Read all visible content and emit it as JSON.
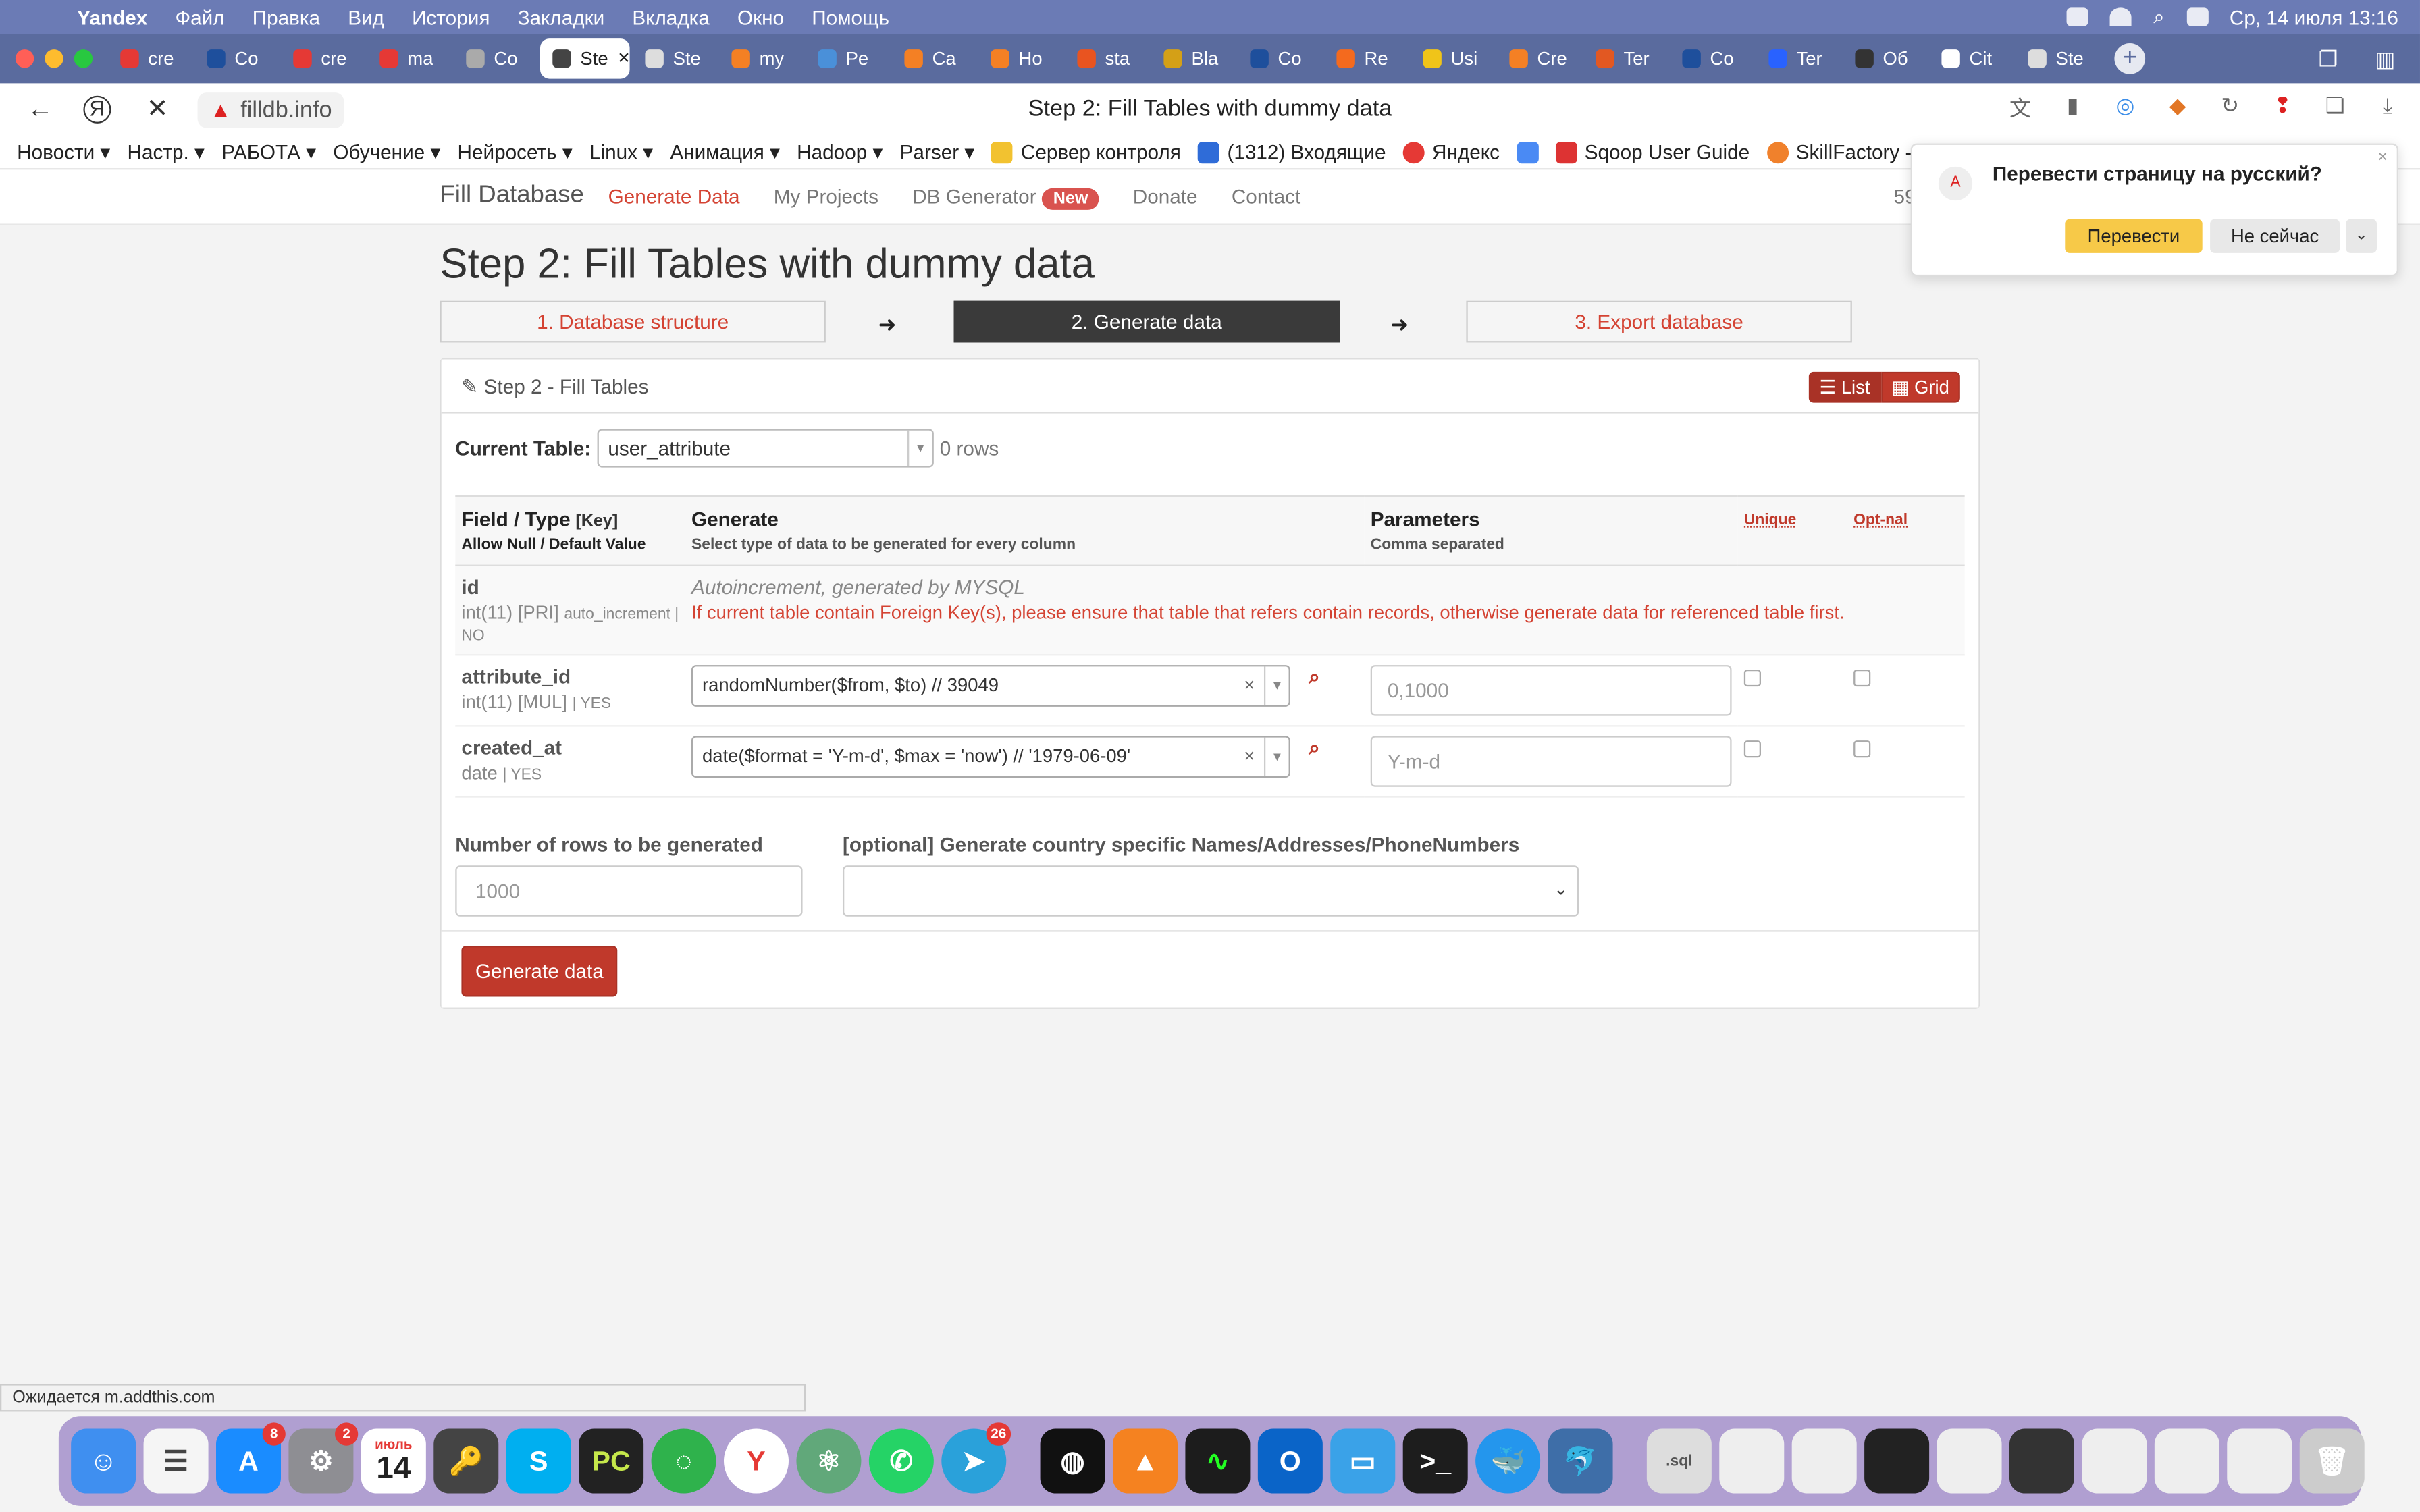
{
  "menubar": {
    "app": "Yandex",
    "items": [
      "Файл",
      "Правка",
      "Вид",
      "История",
      "Закладки",
      "Вкладка",
      "Окно",
      "Помощь"
    ],
    "clock": "Ср, 14 июля  13:16"
  },
  "tabs": [
    {
      "label": "cre",
      "color": "#e53935"
    },
    {
      "label": "Co",
      "color": "#1e4f9c"
    },
    {
      "label": "cre",
      "color": "#e53935"
    },
    {
      "label": "ma",
      "color": "#e53935"
    },
    {
      "label": "Co",
      "color": "#aaaaaa"
    },
    {
      "label": "Ste",
      "color": "#444444"
    },
    {
      "label": "Ste",
      "color": "#dddddd"
    },
    {
      "label": "my",
      "color": "#f48024"
    },
    {
      "label": "Pe",
      "color": "#4a90d9"
    },
    {
      "label": "Ca",
      "color": "#f48024"
    },
    {
      "label": "Ho",
      "color": "#f48024"
    },
    {
      "label": "sta",
      "color": "#e95420"
    },
    {
      "label": "Bla",
      "color": "#d4a017"
    },
    {
      "label": "Co",
      "color": "#1e4f9c"
    },
    {
      "label": "Re",
      "color": "#f46a1e"
    },
    {
      "label": "Usi",
      "color": "#f0c419"
    },
    {
      "label": "Cre",
      "color": "#f48024"
    },
    {
      "label": "Ter",
      "color": "#e25822"
    },
    {
      "label": "Co",
      "color": "#1e4f9c"
    },
    {
      "label": "Ter",
      "color": "#2962ff"
    },
    {
      "label": "Об",
      "color": "#333333"
    },
    {
      "label": "Cit",
      "color": "#ffffff"
    },
    {
      "label": "Ste",
      "color": "#dddddd"
    }
  ],
  "active_tab": 5,
  "toolbar": {
    "url": "filldb.info",
    "page_title": "Step 2: Fill Tables with dummy data"
  },
  "bookmarks": [
    "Новости ▾",
    "Настр. ▾",
    "РАБОТА ▾",
    "Обучение ▾",
    "Нейросеть ▾",
    "Linux ▾",
    "Анимация ▾",
    "Hadoop ▾",
    "Parser ▾",
    "Сервер контроля",
    "(1312) Входящие",
    "Яндекс",
    "",
    "Sqoop User Guide",
    "SkillFactory - Ju"
  ],
  "site": {
    "brand": "Fill Database",
    "links": [
      "Generate Data",
      "My Projects",
      "DB Generator",
      "Donate",
      "Contact"
    ],
    "new_badge": "New",
    "count": "59"
  },
  "page": {
    "heading": "Step 2: Fill Tables with dummy data",
    "steps": [
      "1. Database structure",
      "2. Generate data",
      "3. Export database"
    ],
    "arrow": "➜",
    "panel_title": "Step 2 - Fill Tables",
    "view_list": "List",
    "view_grid": "Grid",
    "current_table_label": "Current Table:",
    "current_table": "user_attribute",
    "rows": "0 rows",
    "headers": {
      "field": "Field / Type",
      "key": "[Key]",
      "field_sub": "Allow Null / Default Value",
      "generate": "Generate",
      "generate_sub": "Select type of data to be generated for every column",
      "params": "Parameters",
      "params_sub": "Comma separated",
      "unique": "Unique",
      "optional": "Opt-nal"
    },
    "fields": [
      {
        "name": "id",
        "type": "int(11) [PRI]",
        "extra": "auto_increment | NO",
        "auto": "Autoincrement, generated by MYSQL",
        "warn": "If current table contain Foreign Key(s), please ensure that table that refers contain records, otherwise generate data for referenced table first."
      },
      {
        "name": "attribute_id",
        "type": "int(11) [MUL]",
        "extra": "| YES",
        "generator": "randomNumber($from, $to) // 39049",
        "params": "0,1000"
      },
      {
        "name": "created_at",
        "type": "date",
        "extra": "| YES",
        "generator": "date($format = 'Y-m-d', $max = 'now') // '1979-06-09'",
        "params": "Y-m-d"
      }
    ],
    "rows_label": "Number of rows to be generated",
    "rows_placeholder": "1000",
    "country_label": "[optional] Generate country specific Names/Addresses/PhoneNumbers",
    "generate_button": "Generate data"
  },
  "translate": {
    "question": "Перевести страницу на русский?",
    "yes": "Перевести",
    "no": "Не сейчас"
  },
  "status": "Ожидается m.addthis.com",
  "dock": {
    "badges": {
      "appstore": "8",
      "settings": "2",
      "calendar_month": "июль",
      "calendar_day": "14",
      "telegram": "26"
    }
  }
}
